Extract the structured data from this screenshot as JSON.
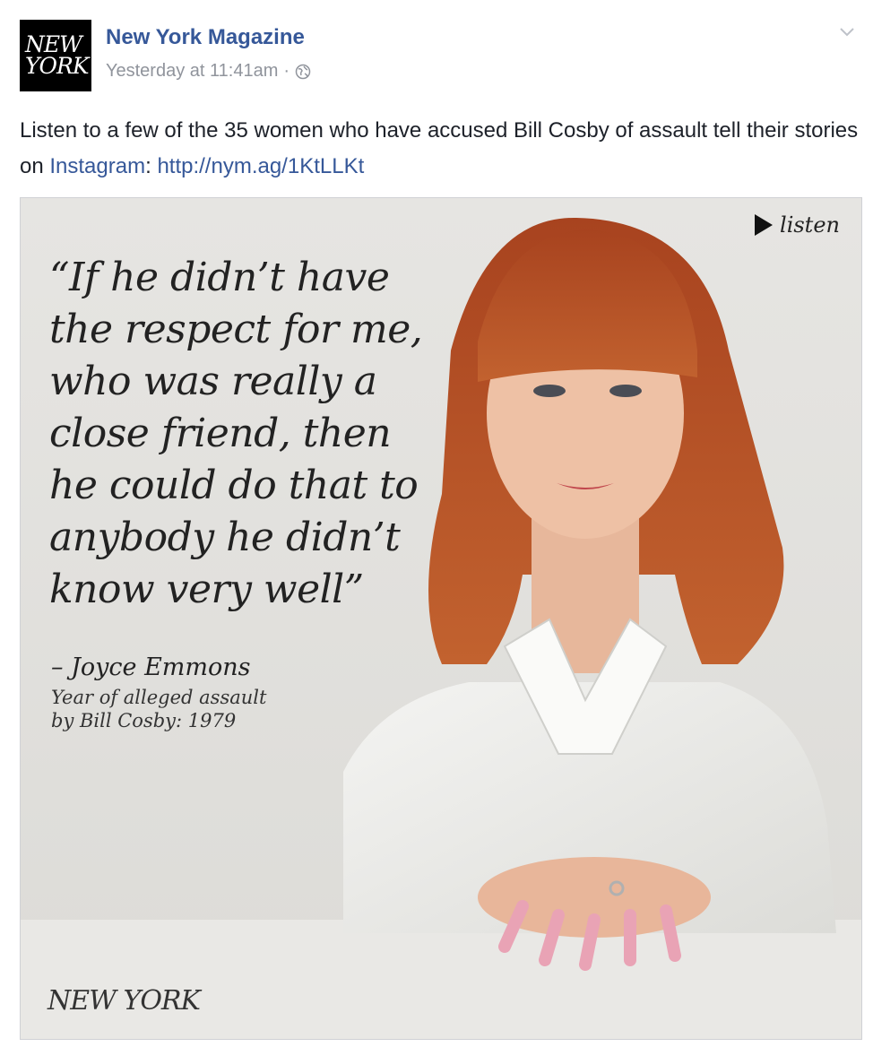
{
  "post": {
    "page_name": "New York Magazine",
    "avatar_text": [
      "NEW",
      "YORK"
    ],
    "timestamp": "Yesterday at 11:41am",
    "separator": "·",
    "audience_icon": "globe-icon",
    "menu_icon": "chevron-down-icon",
    "text_before": "Listen to a few of the 35 women who have accused Bill Cosby of assault tell their stories on ",
    "link_instagram": "Instagram",
    "text_middle": ": ",
    "link_url": "http://nym.ag/1KtLLKt"
  },
  "photo": {
    "quote": "“If he didn’t have the respect for me, who was really a close friend, then he could do that to anybody he didn’t know very well”",
    "attribution": "– Joyce Emmons",
    "detail_line1": "Year of alleged assault",
    "detail_line2": "by Bill Cosby: 1979",
    "listen_label": "listen",
    "logo_text": "NEW YORK"
  },
  "colors": {
    "link": "#365899",
    "meta": "#90949c",
    "hair": "#b5502a",
    "background": "#e2e1de"
  }
}
